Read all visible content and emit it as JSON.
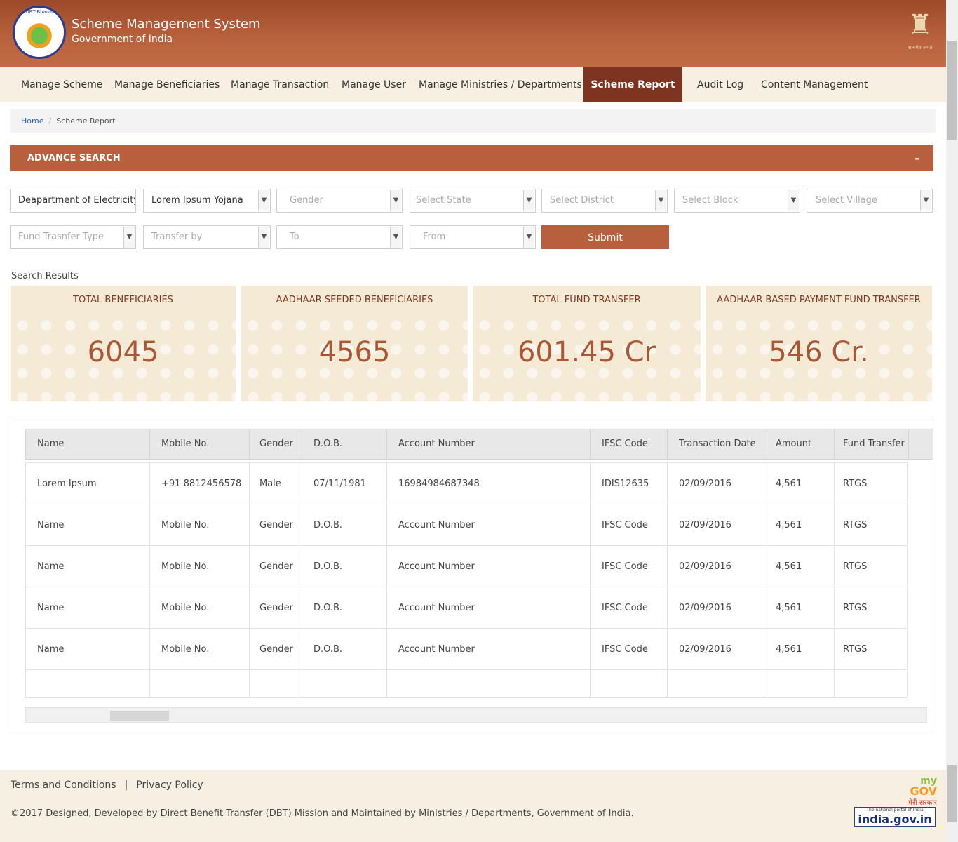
{
  "header": {
    "logo_text": "DBT-Bharat",
    "title": "Scheme Management System",
    "subtitle": "Government of India",
    "emblem_motto": "सत्यमेव जयते"
  },
  "nav": {
    "items": [
      {
        "label": "Manage Scheme"
      },
      {
        "label": "Manage Beneficiaries"
      },
      {
        "label": "Manage Transaction"
      },
      {
        "label": "Manage User"
      },
      {
        "label": "Manage Ministries / Departments"
      },
      {
        "label": "Scheme Report",
        "active": true
      },
      {
        "label": "Audit Log"
      },
      {
        "label": "Content Management"
      }
    ]
  },
  "breadcrumb": {
    "home": "Home",
    "current": "Scheme Report"
  },
  "advance_search": {
    "title": "ADVANCE SEARCH",
    "toggle": "-",
    "department": "Deapartment of Electricity...",
    "scheme": "Lorem Ipsum Yojana",
    "gender_placeholder": "Gender",
    "state_placeholder": "Select State",
    "district_placeholder": "Select District",
    "block_placeholder": "Select Block",
    "village_placeholder": "Select Village",
    "fund_type_placeholder": "Fund Trasnfer Type",
    "transfer_by_placeholder": "Transfer by",
    "to_placeholder": "To",
    "from_placeholder": "From",
    "submit_label": "Submit"
  },
  "results": {
    "label": "Search Results",
    "cards": [
      {
        "title": "TOTAL BENEFICIARIES",
        "value": "6045"
      },
      {
        "title": "AADHAAR SEEDED BENEFICIARIES",
        "value": "4565"
      },
      {
        "title": "TOTAL FUND TRANSFER",
        "value": "601.45 Cr"
      },
      {
        "title": "AADHAAR BASED PAYMENT FUND TRANSFER",
        "value": "546 Cr."
      }
    ]
  },
  "table": {
    "headers": [
      "Name",
      "Mobile No.",
      "Gender",
      "D.O.B.",
      "Account Number",
      "IFSC Code",
      "Transaction Date",
      "Amount",
      "Fund Transfer"
    ],
    "rows": [
      [
        "Lorem Ipsum",
        "+91 8812456578",
        "Male",
        "07/11/1981",
        "16984984687348",
        "IDIS12635",
        "02/09/2016",
        "4,561",
        "RTGS"
      ],
      [
        "Name",
        "Mobile No.",
        "Gender",
        "D.O.B.",
        "Account Number",
        "IFSC Code",
        "02/09/2016",
        "4,561",
        "RTGS"
      ],
      [
        "Name",
        "Mobile No.",
        "Gender",
        "D.O.B.",
        "Account Number",
        "IFSC Code",
        "02/09/2016",
        "4,561",
        "RTGS"
      ],
      [
        "Name",
        "Mobile No.",
        "Gender",
        "D.O.B.",
        "Account Number",
        "IFSC Code",
        "02/09/2016",
        "4,561",
        "RTGS"
      ],
      [
        "Name",
        "Mobile No.",
        "Gender",
        "D.O.B.",
        "Account Number",
        "IFSC Code",
        "02/09/2016",
        "4,561",
        "RTGS"
      ]
    ]
  },
  "footer": {
    "terms": "Terms and Conditions",
    "divider": "|",
    "privacy": "Privacy Policy",
    "copyright": "©2017 Designed, Developed by Direct Benefit Transfer (DBT) Mission and Maintained by Ministries / Departments, Government of India.",
    "mygov_my": "my",
    "mygov_gov": "GOV",
    "mygov_sarkar": "मेरी सरकार",
    "indiagov_small": "The national portal of India",
    "indiagov_big": "india.gov.in"
  },
  "colors": {
    "header": "#b8613c",
    "accent": "#b8603e",
    "nav_active": "#7d3421",
    "card_bg": "#f5ead6",
    "card_value": "#a95734"
  }
}
